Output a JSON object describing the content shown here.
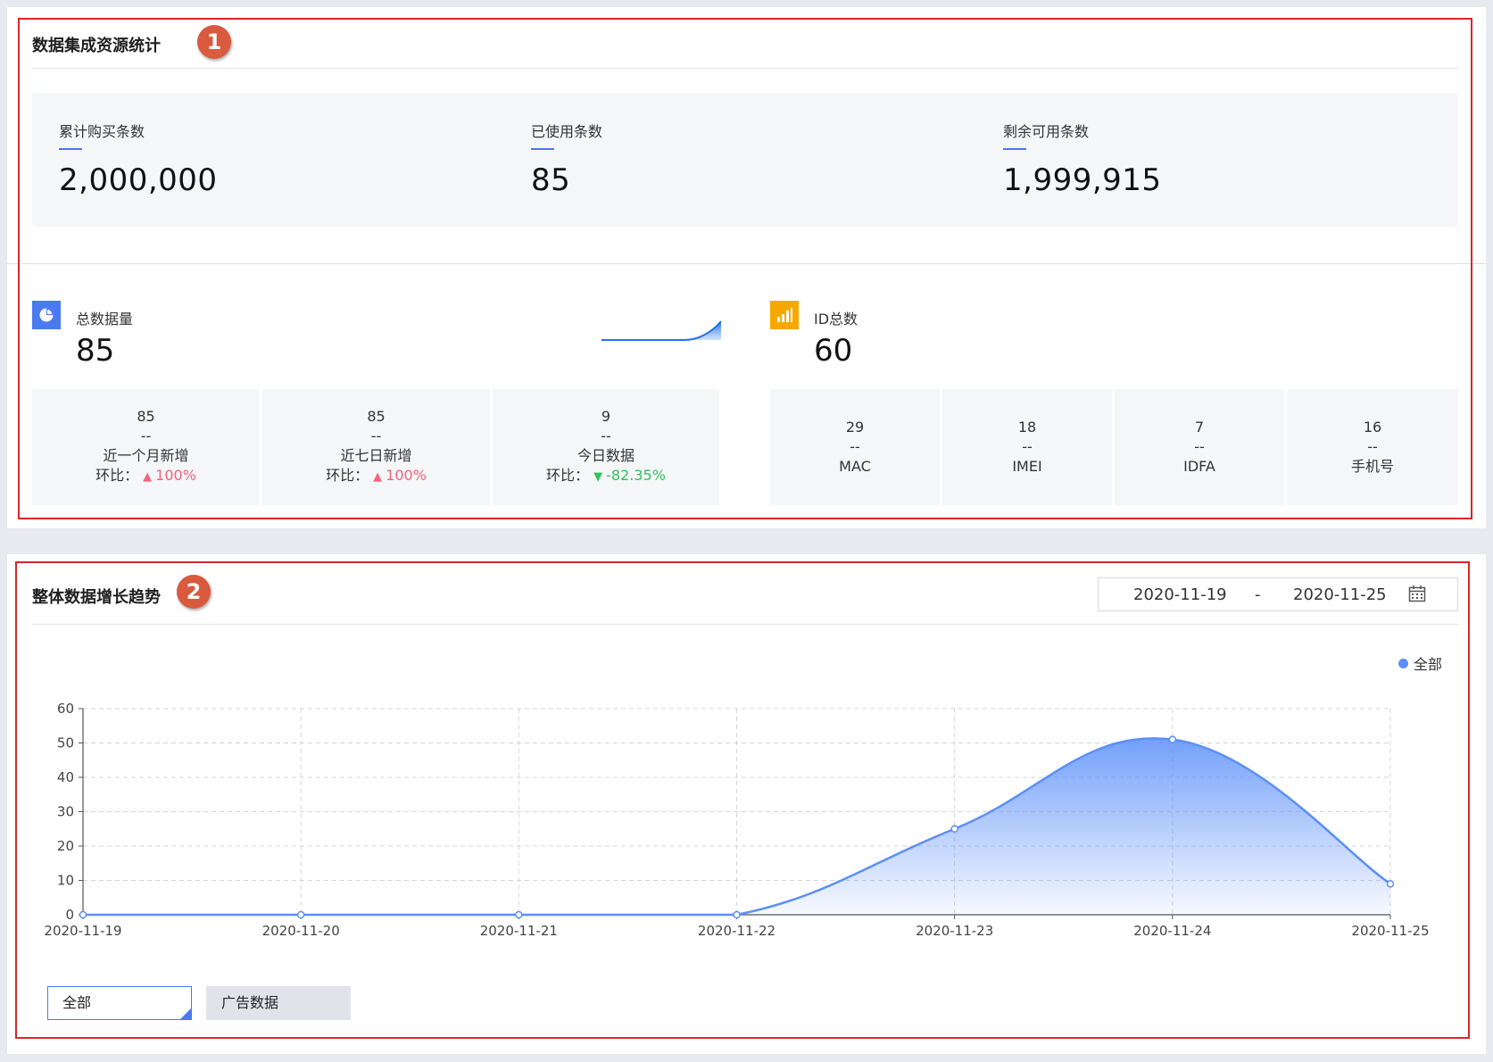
{
  "section1": {
    "title": "数据集成资源统计",
    "badge": "1",
    "summary": [
      {
        "label": "累计购买条数",
        "value": "2,000,000"
      },
      {
        "label": "已使用条数",
        "value": "85"
      },
      {
        "label": "剩余可用条数",
        "value": "1,999,915"
      }
    ],
    "total": {
      "icon": "pie-chart-icon",
      "label": "总数据量",
      "value": "85",
      "cells": [
        {
          "value": "85",
          "dash": "--",
          "label": "近一个月新增",
          "ratio_label": "环比：",
          "ratio": "100%",
          "trend": "up"
        },
        {
          "value": "85",
          "dash": "--",
          "label": "近七日新增",
          "ratio_label": "环比：",
          "ratio": "100%",
          "trend": "up"
        },
        {
          "value": "9",
          "dash": "--",
          "label": "今日数据",
          "ratio_label": "环比：",
          "ratio": "-82.35%",
          "trend": "down"
        }
      ]
    },
    "ids": {
      "icon": "bar-chart-icon",
      "label": "ID总数",
      "value": "60",
      "cells": [
        {
          "value": "29",
          "dash": "--",
          "label": "MAC"
        },
        {
          "value": "18",
          "dash": "--",
          "label": "IMEI"
        },
        {
          "value": "7",
          "dash": "--",
          "label": "IDFA"
        },
        {
          "value": "16",
          "dash": "--",
          "label": "手机号"
        }
      ]
    }
  },
  "section2": {
    "title": "整体数据增长趋势",
    "badge": "2",
    "date_start": "2020-11-19",
    "date_separator": "-",
    "date_end": "2020-11-25",
    "legend_label": "全部",
    "filters": {
      "all": "全部",
      "ad": "广告数据"
    }
  },
  "colors": {
    "accent": "#4a7af0",
    "series": "#5b8ff9",
    "up": "#f2637b",
    "down": "#2fc25b",
    "pie_icon_bg": "#4a7af0",
    "bar_icon_bg": "#f7a800",
    "frame": "#d9262b"
  },
  "chart_data": {
    "type": "area",
    "x": [
      "2020-11-19",
      "2020-11-20",
      "2020-11-21",
      "2020-11-22",
      "2020-11-23",
      "2020-11-24",
      "2020-11-25"
    ],
    "series": [
      {
        "name": "全部",
        "values": [
          0,
          0,
          0,
          0,
          25,
          51,
          9
        ]
      }
    ],
    "ylim": [
      0,
      60
    ],
    "yticks": [
      0,
      10,
      20,
      30,
      40,
      50,
      60
    ],
    "grid": true,
    "legend": "top-right",
    "smooth": true
  }
}
